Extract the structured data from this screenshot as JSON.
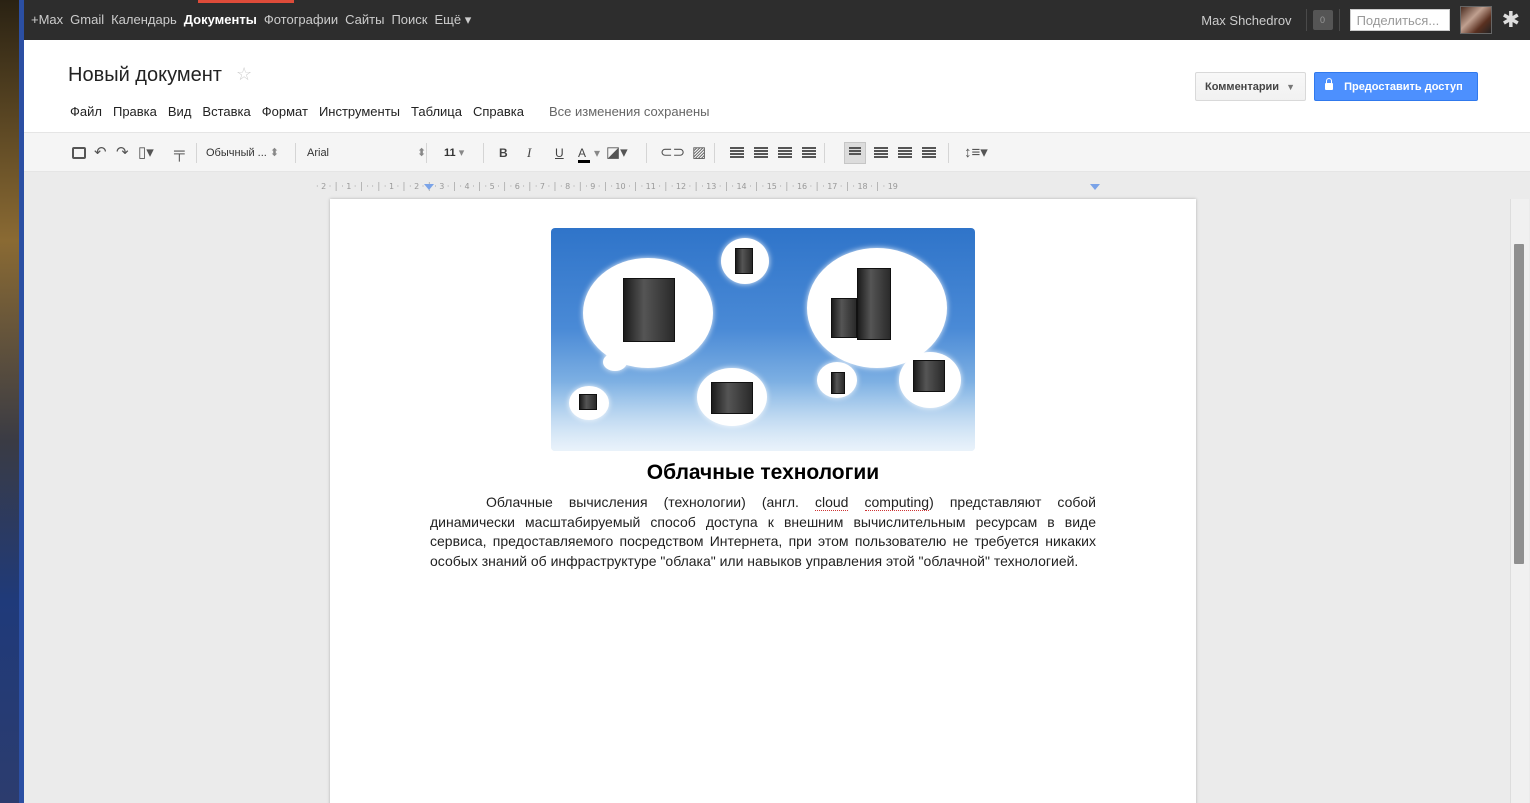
{
  "gbar": {
    "links": [
      "+Max",
      "Gmail",
      "Календарь",
      "Документы",
      "Фотографии",
      "Сайты",
      "Поиск",
      "Ещё ▾"
    ],
    "active_index": 3,
    "user_name": "Max Shchedrov",
    "notifications": "0",
    "share_placeholder": "Поделиться...",
    "settings_icon": "gear-icon"
  },
  "document": {
    "title": "Новый документ",
    "star_icon": "star-icon"
  },
  "menu": {
    "items": [
      "Файл",
      "Правка",
      "Вид",
      "Вставка",
      "Формат",
      "Инструменты",
      "Таблица",
      "Справка"
    ],
    "save_status": "Все изменения сохранены"
  },
  "header_buttons": {
    "comments": "Комментарии",
    "share": "Предоставить доступ"
  },
  "toolbar": {
    "style_select": "Обычный ...",
    "font_select": "Arial",
    "size_select": "11",
    "bold": "B",
    "italic": "I",
    "underline": "U",
    "text_color": "A",
    "select_caret": "⬍",
    "icons": [
      "print-icon",
      "undo-icon",
      "redo-icon",
      "paste-icon",
      "paint-format-icon",
      "link-icon",
      "image-icon",
      "numbered-list-icon",
      "bulleted-list-icon",
      "decrease-indent-icon",
      "increase-indent-icon",
      "align-left-icon",
      "align-center-icon",
      "align-right-icon",
      "justify-icon",
      "line-spacing-icon"
    ]
  },
  "ruler": {
    "text": "· 2 · │ · 1 · │ · · │ · 1 · │ · 2 · │ · 3 · │ · 4 · │ · 5 · │ · 6 · │ · 7 · │ · 8 · │ · 9 · │ · 10 · │ · 11 · │ · 12 · │ · 13 · │ · 14 · │ · 15 · │ · 16 · │ · 17 · │ · 18 · │ · 19"
  },
  "content": {
    "heading": "Облачные технологии",
    "para_before": "Облачные вычисления (технологии) (англ. ",
    "para_term1": "cloud",
    "para_space": " ",
    "para_term2": "computing",
    "para_after": ") представляют собой динамически масштабируемый способ доступа к внешним вычислительным ресурсам в виде сервиса, предоставляемого посредством Интернета, при этом пользователю не требуется никаких особых знаний об инфраструктуре \"облака\" или навыков управления этой \"облачной\" технологией."
  }
}
